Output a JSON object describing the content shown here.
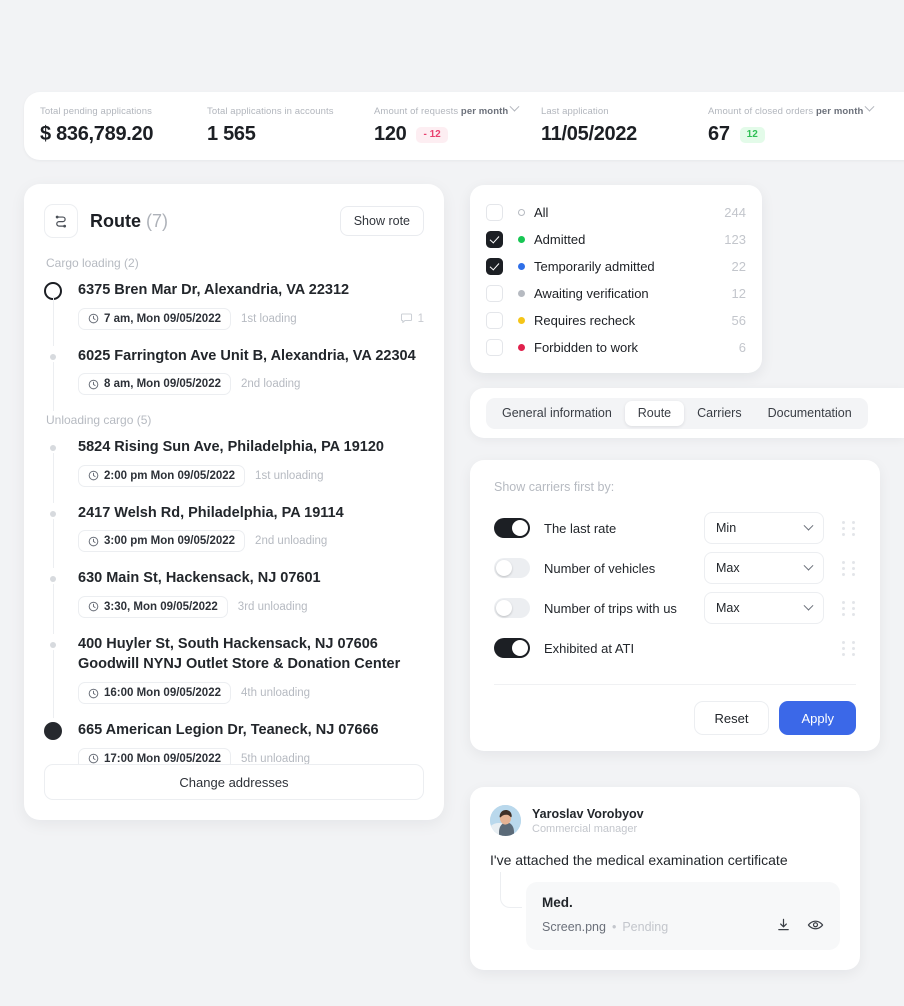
{
  "stats": [
    {
      "label": "Total pending applications",
      "label_bold": "",
      "value": "$ 836,789.20",
      "badge": null,
      "badge_type": null,
      "has_caret": false
    },
    {
      "label": "Total applications in accounts",
      "label_bold": "",
      "value": "1 565",
      "badge": null,
      "badge_type": null,
      "has_caret": false
    },
    {
      "label": "Amount of requests ",
      "label_bold": "per month",
      "value": "120",
      "badge": "- 12",
      "badge_type": "neg",
      "has_caret": true
    },
    {
      "label": "Last application",
      "label_bold": "",
      "value": "11/05/2022",
      "badge": null,
      "badge_type": null,
      "has_caret": false
    },
    {
      "label": "Amount of closed orders ",
      "label_bold": "per month",
      "value": "67",
      "badge": "12",
      "badge_type": "pos",
      "has_caret": true
    }
  ],
  "route": {
    "icon": "route-path-icon",
    "title": "Route",
    "count": "(7)",
    "show_button": "Show rote",
    "loading_group": "Cargo loading (2)",
    "unloading_group": "Unloading cargo (5)",
    "change_addresses": "Change addresses",
    "loading_stops": [
      {
        "address": "6375 Bren Mar Dr, Alexandria, VA 22312",
        "address2": "",
        "time": "7 am,  Mon 09/05/2022",
        "seq": "1st loading",
        "marker": "ring",
        "comments": "1"
      },
      {
        "address": "6025 Farrington Ave Unit B, Alexandria, VA 22304",
        "address2": "",
        "time": "8 am, Mon 09/05/2022",
        "seq": "2nd loading",
        "marker": "dot",
        "comments": null
      }
    ],
    "unloading_stops": [
      {
        "address": "5824 Rising Sun Ave, Philadelphia, PA 19120",
        "address2": "",
        "time": "2:00 pm  Mon 09/05/2022",
        "seq": "1st unloading",
        "marker": "dot",
        "comments": null
      },
      {
        "address": "2417 Welsh Rd, Philadelphia, PA 19114",
        "address2": "",
        "time": "3:00 pm  Mon 09/05/2022",
        "seq": "2nd unloading",
        "marker": "dot",
        "comments": null
      },
      {
        "address": "630 Main St, Hackensack, NJ 07601",
        "address2": "",
        "time": "3:30,  Mon 09/05/2022",
        "seq": "3rd unloading",
        "marker": "dot",
        "comments": null
      },
      {
        "address": "400 Huyler St, South Hackensack, NJ 07606",
        "address2": "Goodwill NYNJ Outlet Store & Donation Center",
        "time": "16:00  Mon 09/05/2022",
        "seq": "4th unloading",
        "marker": "dot",
        "comments": null
      },
      {
        "address": "665 American Legion Dr, Teaneck, NJ 07666",
        "address2": "",
        "time": "17:00  Mon 09/05/2022",
        "seq": "5th unloading",
        "marker": "filled",
        "comments": null
      }
    ]
  },
  "status_filter": [
    {
      "label": "All",
      "count": "244",
      "checked": false,
      "dot": "ring",
      "color": "#b6bac1"
    },
    {
      "label": "Admitted",
      "count": "123",
      "checked": true,
      "dot": "solid",
      "color": "#17c653"
    },
    {
      "label": "Temporarily admitted",
      "count": "22",
      "checked": true,
      "dot": "solid",
      "color": "#2f6fe8"
    },
    {
      "label": "Awaiting verification",
      "count": "12",
      "checked": false,
      "dot": "solid",
      "color": "#b6bac1"
    },
    {
      "label": "Requires recheck",
      "count": "56",
      "checked": false,
      "dot": "solid",
      "color": "#f5c game"
    },
    {
      "label": "Forbidden to work",
      "count": "6",
      "checked": false,
      "dot": "solid",
      "color": "#e0214c"
    }
  ],
  "tabs": [
    {
      "label": "General information",
      "active": false
    },
    {
      "label": "Route",
      "active": true
    },
    {
      "label": "Carriers",
      "active": false
    },
    {
      "label": "Documentation",
      "active": false
    }
  ],
  "sort": {
    "title": "Show carriers first by:",
    "rows": [
      {
        "label": "The last rate",
        "on": true,
        "select": "Min",
        "has_select": true
      },
      {
        "label": "Number of vehicles",
        "on": false,
        "select": "Max",
        "has_select": true
      },
      {
        "label": "Number of trips with us",
        "on": false,
        "select": "Max",
        "has_select": true
      },
      {
        "label": "Exhibited at ATI",
        "on": true,
        "select": "",
        "has_select": false
      }
    ],
    "reset_label": "Reset",
    "apply_label": "Apply",
    "apply_color": "#3b68e8"
  },
  "message": {
    "sender": "Yaroslav Vorobyov",
    "role": "Commercial manager",
    "text": "I've attached the medical examination certificate",
    "attachment": {
      "title": "Med.",
      "file": "Screen.png",
      "separator": "•",
      "status": "Pending",
      "download_icon": "download-icon",
      "preview_icon": "eye-icon"
    }
  }
}
